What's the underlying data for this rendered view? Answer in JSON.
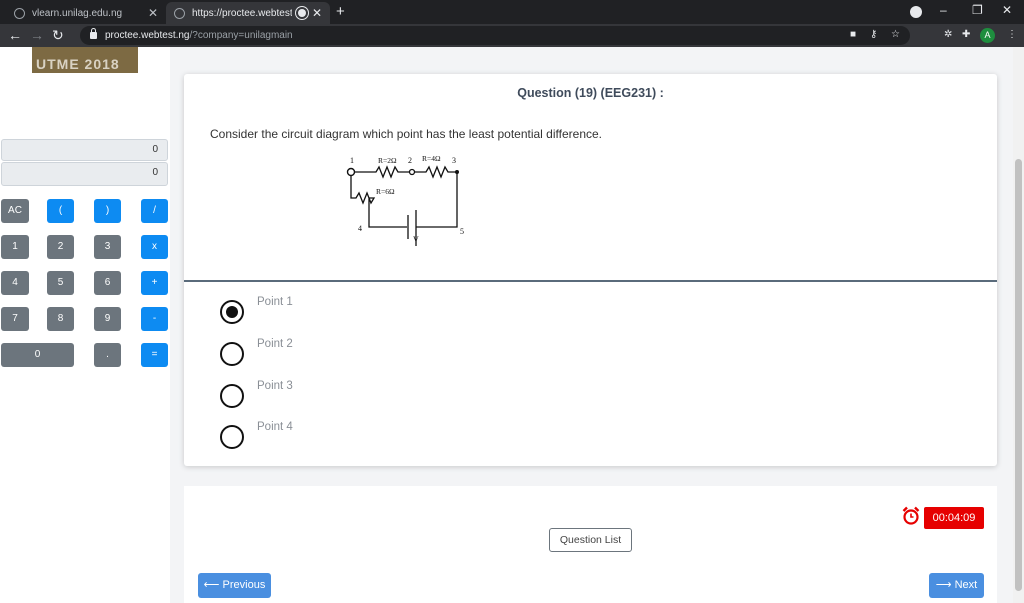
{
  "browser": {
    "tabs": [
      {
        "title": "vlearn.unilag.edu.ng"
      },
      {
        "title": "https://proctee.webtest.ng/?"
      }
    ],
    "url_host": "proctee.webtest.ng",
    "url_path": "/?company=unilagmain",
    "profile_initial": "A"
  },
  "sidebar": {
    "banner_text": "UTME 2018",
    "display_top": "0",
    "display_main": "0",
    "buttons": [
      [
        "AC",
        "(",
        ")",
        "/"
      ],
      [
        "1",
        "2",
        "3",
        "x"
      ],
      [
        "4",
        "5",
        "6",
        "+"
      ],
      [
        "7",
        "8",
        "9",
        "-"
      ],
      [
        "0",
        ".",
        "="
      ]
    ]
  },
  "question": {
    "title": "Question (19) (EEG231) :",
    "text": "Consider the circuit diagram which point has the least potential difference.",
    "circuit": {
      "point_labels": [
        "1",
        "2",
        "3",
        "4",
        "5"
      ],
      "r1": "R=2Ω",
      "r2": "R=4Ω",
      "r3": "R=6Ω",
      "source": "V"
    },
    "options": [
      {
        "label": "Point 1",
        "selected": true
      },
      {
        "label": "Point 2",
        "selected": false
      },
      {
        "label": "Point 3",
        "selected": false
      },
      {
        "label": "Point 4",
        "selected": false
      }
    ]
  },
  "footer": {
    "timer": "00:04:09",
    "question_list": "Question List",
    "previous": "Previous",
    "next": "Next",
    "colors": {
      "timer": "#e60000",
      "nav": "#4a8fe0"
    }
  }
}
